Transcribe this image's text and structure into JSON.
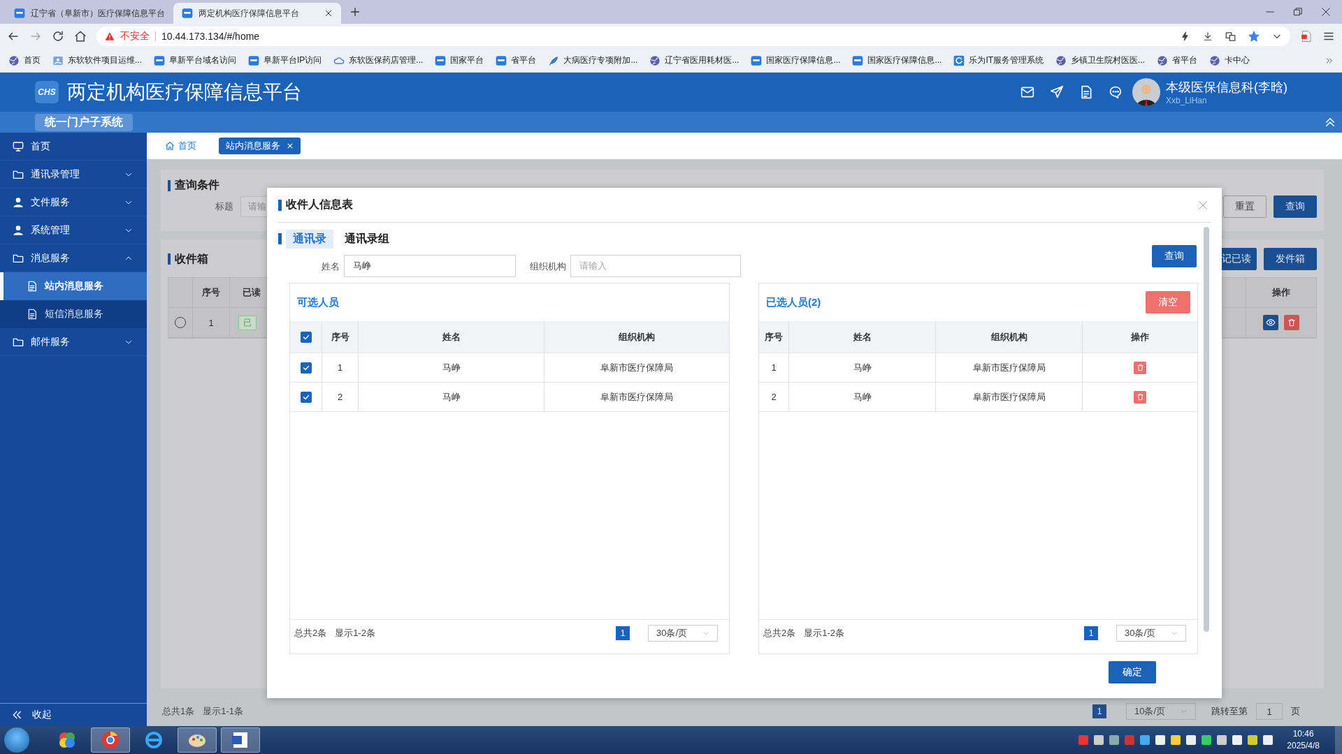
{
  "browser": {
    "tabs": [
      {
        "title": "辽宁省（阜新市）医疗保障信息平台",
        "selected": false
      },
      {
        "title": "两定机构医疗保障信息平台",
        "selected": true
      }
    ],
    "security_label": "不安全",
    "url": "10.44.173.134/#/home",
    "bookmarks": [
      {
        "label": "首页",
        "kind": "globe"
      },
      {
        "label": "东软软件项目运维...",
        "kind": "card"
      },
      {
        "label": "阜新平台域名访问",
        "kind": "square"
      },
      {
        "label": "阜新平台IP访问",
        "kind": "square"
      },
      {
        "label": "东软医保药店管理...",
        "kind": "cloud"
      },
      {
        "label": "国家平台",
        "kind": "square"
      },
      {
        "label": "省平台",
        "kind": "square"
      },
      {
        "label": "大病医疗专项附加...",
        "kind": "leaf"
      },
      {
        "label": "辽宁省医用耗材医...",
        "kind": "globe"
      },
      {
        "label": "国家医疗保障信息...",
        "kind": "square"
      },
      {
        "label": "国家医疗保障信息...",
        "kind": "square"
      },
      {
        "label": "乐为IT服务管理系统",
        "kind": "ring"
      },
      {
        "label": "乡镇卫生院村医医...",
        "kind": "globe"
      },
      {
        "label": "省平台",
        "kind": "globe"
      },
      {
        "label": "卡中心",
        "kind": "globe"
      }
    ]
  },
  "header": {
    "logo_text": "CHS",
    "title": "两定机构医疗保障信息平台",
    "subsystem": "统一门户子系统",
    "user_name": "本级医保信息科(李晗)",
    "user_id": "Xxb_LiHan"
  },
  "sidebar": {
    "items": [
      {
        "label": "首页",
        "kind": "link",
        "selected": false
      },
      {
        "label": "通讯录管理",
        "kind": "group",
        "selected": false,
        "expanded": false
      },
      {
        "label": "文件服务",
        "kind": "group",
        "selected": false,
        "expanded": false
      },
      {
        "label": "系统管理",
        "kind": "group",
        "selected": false,
        "expanded": false
      },
      {
        "label": "消息服务",
        "kind": "group",
        "selected": false,
        "expanded": true,
        "children": [
          {
            "label": "站内消息服务",
            "selected": true
          },
          {
            "label": "短信消息服务",
            "selected": false
          }
        ]
      },
      {
        "label": "邮件服务",
        "kind": "group",
        "selected": false,
        "expanded": false
      }
    ],
    "collapse_label": "收起"
  },
  "page_tabs": [
    {
      "label": "首页",
      "selected": false,
      "closable": false
    },
    {
      "label": "站内消息服务",
      "selected": true,
      "closable": true
    }
  ],
  "query_card": {
    "title": "查询条件",
    "field_label": "标题",
    "field_placeholder": "请输",
    "buttons": [
      {
        "label": "重置",
        "kind": "default"
      },
      {
        "label": "查询",
        "kind": "primary"
      }
    ]
  },
  "inbox_card": {
    "title": "收件箱",
    "buttons": [
      {
        "label": "记已读",
        "kind": "primary"
      },
      {
        "label": "发件箱",
        "kind": "primary"
      }
    ],
    "columns": [
      "序号",
      "已读",
      "操作"
    ],
    "rows": [
      {
        "selected": false,
        "index": "1",
        "read_tag": "已"
      }
    ],
    "total": "总共1条",
    "range": "显示1-1条",
    "page": "1",
    "page_size": "10条/页",
    "jump_label": "跳转至第",
    "jump_value": "1",
    "jump_suffix": "页"
  },
  "dialog": {
    "title": "收件人信息表",
    "tabs": [
      {
        "label": "通讯录",
        "selected": true
      },
      {
        "label": "通讯录组",
        "selected": false
      }
    ],
    "name_label": "姓名",
    "name_value": "马峥",
    "org_label": "组织机构",
    "org_placeholder": "请输入",
    "query_button": "查询",
    "available": {
      "title": "可选人员",
      "all_checked": true,
      "columns": [
        "序号",
        "姓名",
        "组织机构"
      ],
      "rows": [
        {
          "checked": true,
          "index": "1",
          "name": "马峥",
          "org": "阜新市医疗保障局"
        },
        {
          "checked": true,
          "index": "2",
          "name": "马峥",
          "org": "阜新市医疗保障局"
        }
      ],
      "total": "总共2条",
      "range": "显示1-2条",
      "page": "1",
      "page_size": "30条/页"
    },
    "chosen": {
      "title": "已选人员(2)",
      "clear_button": "清空",
      "columns": [
        "序号",
        "姓名",
        "组织机构",
        "操作"
      ],
      "rows": [
        {
          "index": "1",
          "name": "马峥",
          "org": "阜新市医疗保障局"
        },
        {
          "index": "2",
          "name": "马峥",
          "org": "阜新市医疗保障局"
        }
      ],
      "total": "总共2条",
      "range": "显示1-2条",
      "page": "1",
      "page_size": "30条/页"
    },
    "confirm_button": "确定"
  },
  "taskbar": {
    "time": "10:46",
    "date": "2025/4/8"
  }
}
